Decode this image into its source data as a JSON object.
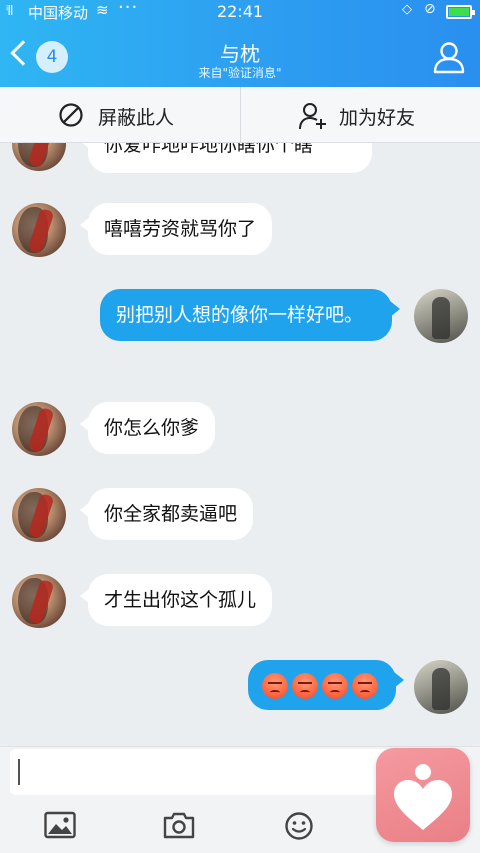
{
  "status_bar": {
    "signal": "⁵ᵢ|l",
    "carrier": "中国移动",
    "more": "···",
    "time": "22:41"
  },
  "header": {
    "back_badge": "4",
    "title": "与枕",
    "subtitle": "来自\"验证消息\""
  },
  "actions": {
    "block_label": "屏蔽此人",
    "add_friend_label": "加为好友"
  },
  "messages": [
    {
      "side": "them",
      "text": "你爱咋地咋地你瞎你个瞎"
    },
    {
      "side": "them",
      "text": "嘻嘻劳资就骂你了"
    },
    {
      "side": "me",
      "text": "别把别人想的像你一样好吧。"
    },
    {
      "side": "them",
      "text": "你怎么你爹"
    },
    {
      "side": "them",
      "text": "你全家都卖逼吧"
    },
    {
      "side": "them",
      "text": "才生出你这个孤儿"
    },
    {
      "side": "me",
      "emoji_count": 4,
      "emoji": "angry-face"
    }
  ],
  "input": {
    "value": "",
    "placeholder": ""
  },
  "toolbar": {
    "icons": [
      "image-icon",
      "camera-icon",
      "emoji-icon"
    ]
  },
  "colors": {
    "header_blue": "#2d9ef0",
    "sent_bubble": "#1fa3ec",
    "received_bubble": "#ffffff",
    "float_button": "#ea7f86"
  }
}
